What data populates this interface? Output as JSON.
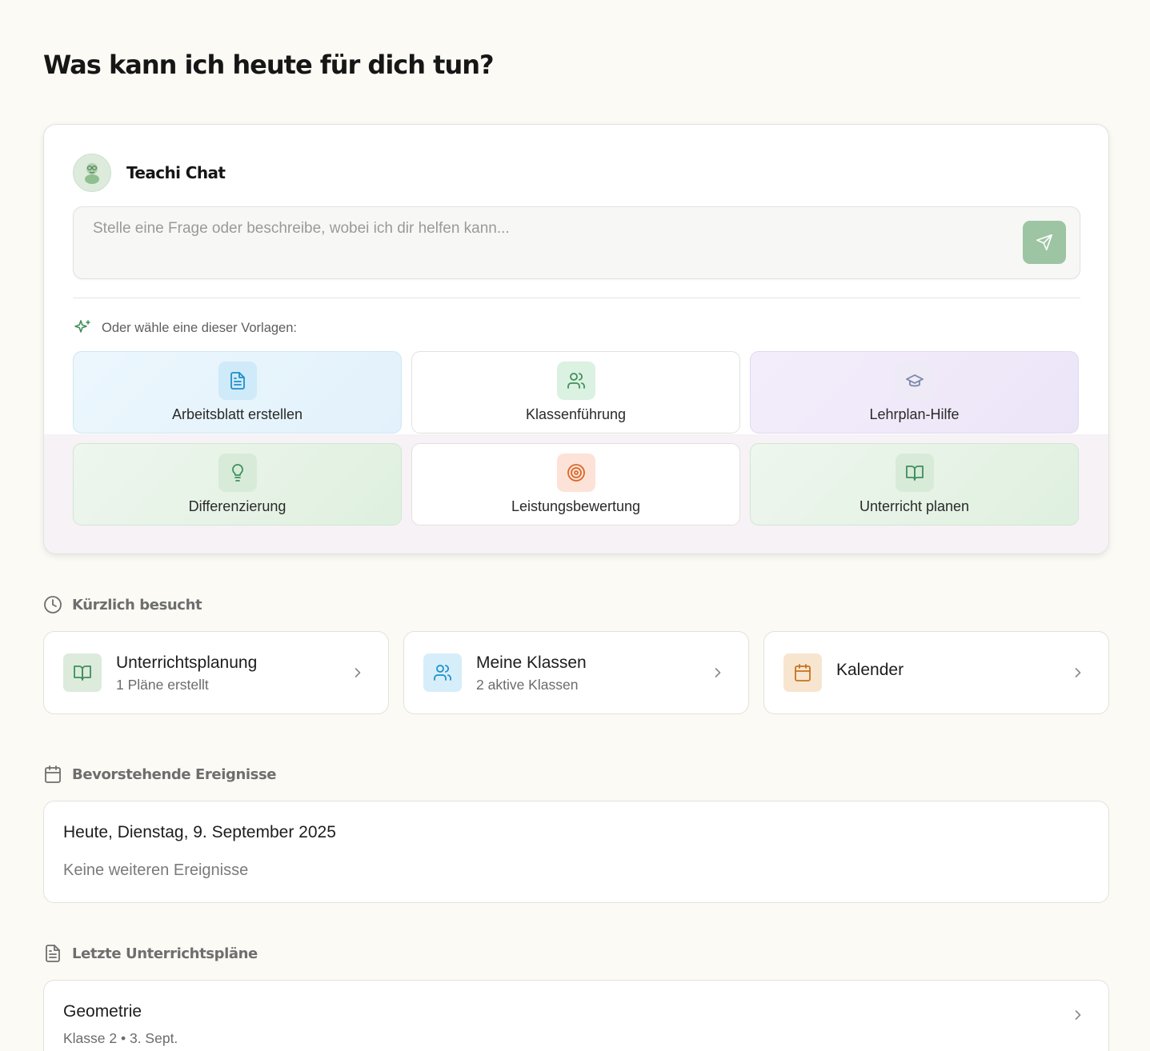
{
  "page": {
    "title": "Was kann ich heute für dich tun?"
  },
  "chat": {
    "title": "Teachi Chat",
    "placeholder": "Stelle eine Frage oder beschreibe, wobei ich dir helfen kann...",
    "send_icon": "send-icon",
    "templates_label": "Oder wähle eine dieser Vorlagen:",
    "templates": [
      {
        "label": "Arbeitsblatt erstellen",
        "icon": "document-icon",
        "color": "#1e8fc9"
      },
      {
        "label": "Klassenführung",
        "icon": "users-icon",
        "color": "#3f8f5a"
      },
      {
        "label": "Lehrplan-Hilfe",
        "icon": "graduation-cap-icon",
        "color": "#7a86a8"
      },
      {
        "label": "Differenzierung",
        "icon": "lightbulb-icon",
        "color": "#3f8f5a"
      },
      {
        "label": "Leistungsbewertung",
        "icon": "target-icon",
        "color": "#d9692a"
      },
      {
        "label": "Unterricht planen",
        "icon": "book-open-icon",
        "color": "#3f8f5a"
      }
    ]
  },
  "recent": {
    "heading": "Kürzlich besucht",
    "items": [
      {
        "title": "Unterrichtsplanung",
        "subtitle": "1 Pläne erstellt",
        "icon": "book-open-icon"
      },
      {
        "title": "Meine Klassen",
        "subtitle": "2 aktive Klassen",
        "icon": "users-icon"
      },
      {
        "title": "Kalender",
        "subtitle": "",
        "icon": "calendar-icon"
      }
    ]
  },
  "events": {
    "heading": "Bevorstehende Ereignisse",
    "date": "Heute, Dienstag, 9. September 2025",
    "empty": "Keine weiteren Ereignisse"
  },
  "plans": {
    "heading": "Letzte Unterrichtspläne",
    "items": [
      {
        "title": "Geometrie",
        "subtitle": "Klasse 2 • 3. Sept."
      }
    ]
  }
}
